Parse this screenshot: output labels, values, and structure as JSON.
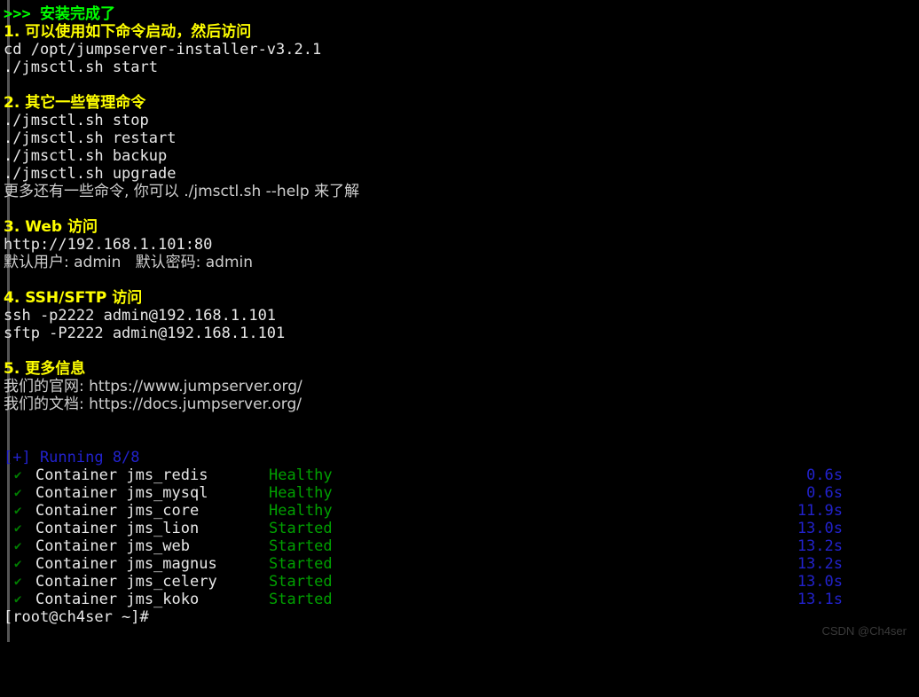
{
  "terminal": {
    "background": "#000000",
    "colors": {
      "green_bright": "#00ff00",
      "yellow": "#ffff00",
      "white": "#e8e8e8",
      "grey": "#cfcfcf",
      "blue": "#2222cc",
      "green_dark": "#00a000",
      "check_green": "#008000",
      "watermark": "#3a3a3a",
      "scrollbar": "#555555"
    },
    "banner": {
      "prefix": ">>>",
      "text": "安装完成了"
    },
    "sections": [
      {
        "heading": "1. 可以使用如下命令启动，然后访问",
        "lines": [
          "cd /opt/jumpserver-installer-v3.2.1",
          "./jmsctl.sh start"
        ]
      },
      {
        "heading": "2. 其它一些管理命令",
        "lines": [
          "./jmsctl.sh stop",
          "./jmsctl.sh restart",
          "./jmsctl.sh backup",
          "./jmsctl.sh upgrade"
        ],
        "note": "更多还有一些命令, 你可以 ./jmsctl.sh --help 来了解"
      },
      {
        "heading": "3. Web 访问",
        "lines": [
          "http://192.168.1.101:80"
        ],
        "credentials": "默认用户: admin   默认密码: admin"
      },
      {
        "heading": "4. SSH/SFTP 访问",
        "lines": [
          "ssh -p2222 admin@192.168.1.101",
          "sftp -P2222 admin@192.168.1.101"
        ]
      },
      {
        "heading": "5. 更多信息",
        "info": [
          "我们的官网: https://www.jumpserver.org/",
          "我们的文档: https://docs.jumpserver.org/"
        ]
      }
    ],
    "compose": {
      "summary": "[+] Running 8/8",
      "check_glyph": "✔",
      "containers": [
        {
          "label": "Container jms_redis",
          "status": "Healthy",
          "elapsed": "0.6s"
        },
        {
          "label": "Container jms_mysql",
          "status": "Healthy",
          "elapsed": "0.6s"
        },
        {
          "label": "Container jms_core",
          "status": "Healthy",
          "elapsed": "11.9s"
        },
        {
          "label": "Container jms_lion",
          "status": "Started",
          "elapsed": "13.0s"
        },
        {
          "label": "Container jms_web",
          "status": "Started",
          "elapsed": "13.2s"
        },
        {
          "label": "Container jms_magnus",
          "status": "Started",
          "elapsed": "13.2s"
        },
        {
          "label": "Container jms_celery",
          "status": "Started",
          "elapsed": "13.0s"
        },
        {
          "label": "Container jms_koko",
          "status": "Started",
          "elapsed": "13.1s"
        }
      ]
    },
    "prompt": "[root@ch4ser ~]#",
    "watermark": "CSDN @Ch4ser"
  }
}
